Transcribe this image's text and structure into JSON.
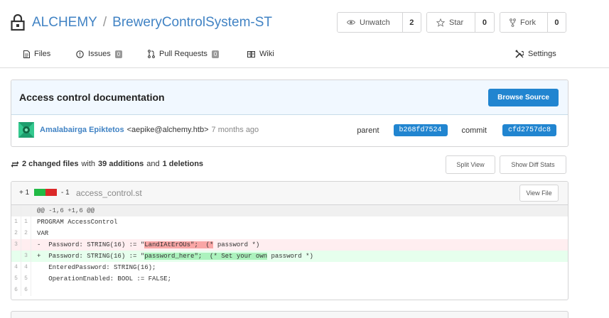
{
  "repo": {
    "owner": "ALCHEMY",
    "separator": "/",
    "name": "BreweryControlSystem-ST"
  },
  "actions": {
    "watch": {
      "label": "Unwatch",
      "count": "2"
    },
    "star": {
      "label": "Star",
      "count": "0"
    },
    "fork": {
      "label": "Fork",
      "count": "0"
    }
  },
  "tabs": {
    "files": "Files",
    "issues": "Issues",
    "issues_count": "0",
    "pulls": "Pull Requests",
    "pulls_count": "0",
    "wiki": "Wiki",
    "settings": "Settings"
  },
  "commit": {
    "title": "Access control documentation",
    "browse_label": "Browse Source",
    "author": "Amalabairga Epiktetos",
    "email": "<aepike@alchemy.htb>",
    "time": "7 months ago",
    "parent_label": "parent",
    "parent_sha": "b268fd7524",
    "commit_label": "commit",
    "commit_sha": "cfd2757dc8"
  },
  "stats": {
    "files_changed": "2 changed files",
    "with": "with",
    "additions": "39 additions",
    "and": "and",
    "deletions": "1 deletions",
    "split_view": "Split View",
    "show_diff_stats": "Show Diff Stats"
  },
  "file": {
    "additions": "+ 1",
    "deletions": "- 1",
    "filename": "access_control.st",
    "view_file": "View File",
    "hunk": "@@ -1,6 +1,6 @@",
    "lines": [
      {
        "old": "1",
        "new": "1",
        "text": "PROGRAM AccessControl"
      },
      {
        "old": "2",
        "new": "2",
        "text": "VAR"
      },
      {
        "old": "3",
        "new": "",
        "pre": "-  Password: STRING(16) := \"",
        "hl": "LandIAtErOUs\";  (*",
        "post": " password *)"
      },
      {
        "old": "",
        "new": "3",
        "pre": "+  Password: STRING(16) := \"",
        "hl": "password_here\";  (* Set your own",
        "post": " password *)"
      },
      {
        "old": "4",
        "new": "4",
        "text": "   EnteredPassword: STRING(16);"
      },
      {
        "old": "5",
        "new": "5",
        "text": "   OperationEnabled: BOOL := FALSE;"
      },
      {
        "old": "6",
        "new": "6",
        "text": ""
      }
    ]
  },
  "colors": {
    "link": "#4183c4",
    "primary": "#2185d0",
    "added": "#21ba45",
    "deleted": "#db2828"
  }
}
